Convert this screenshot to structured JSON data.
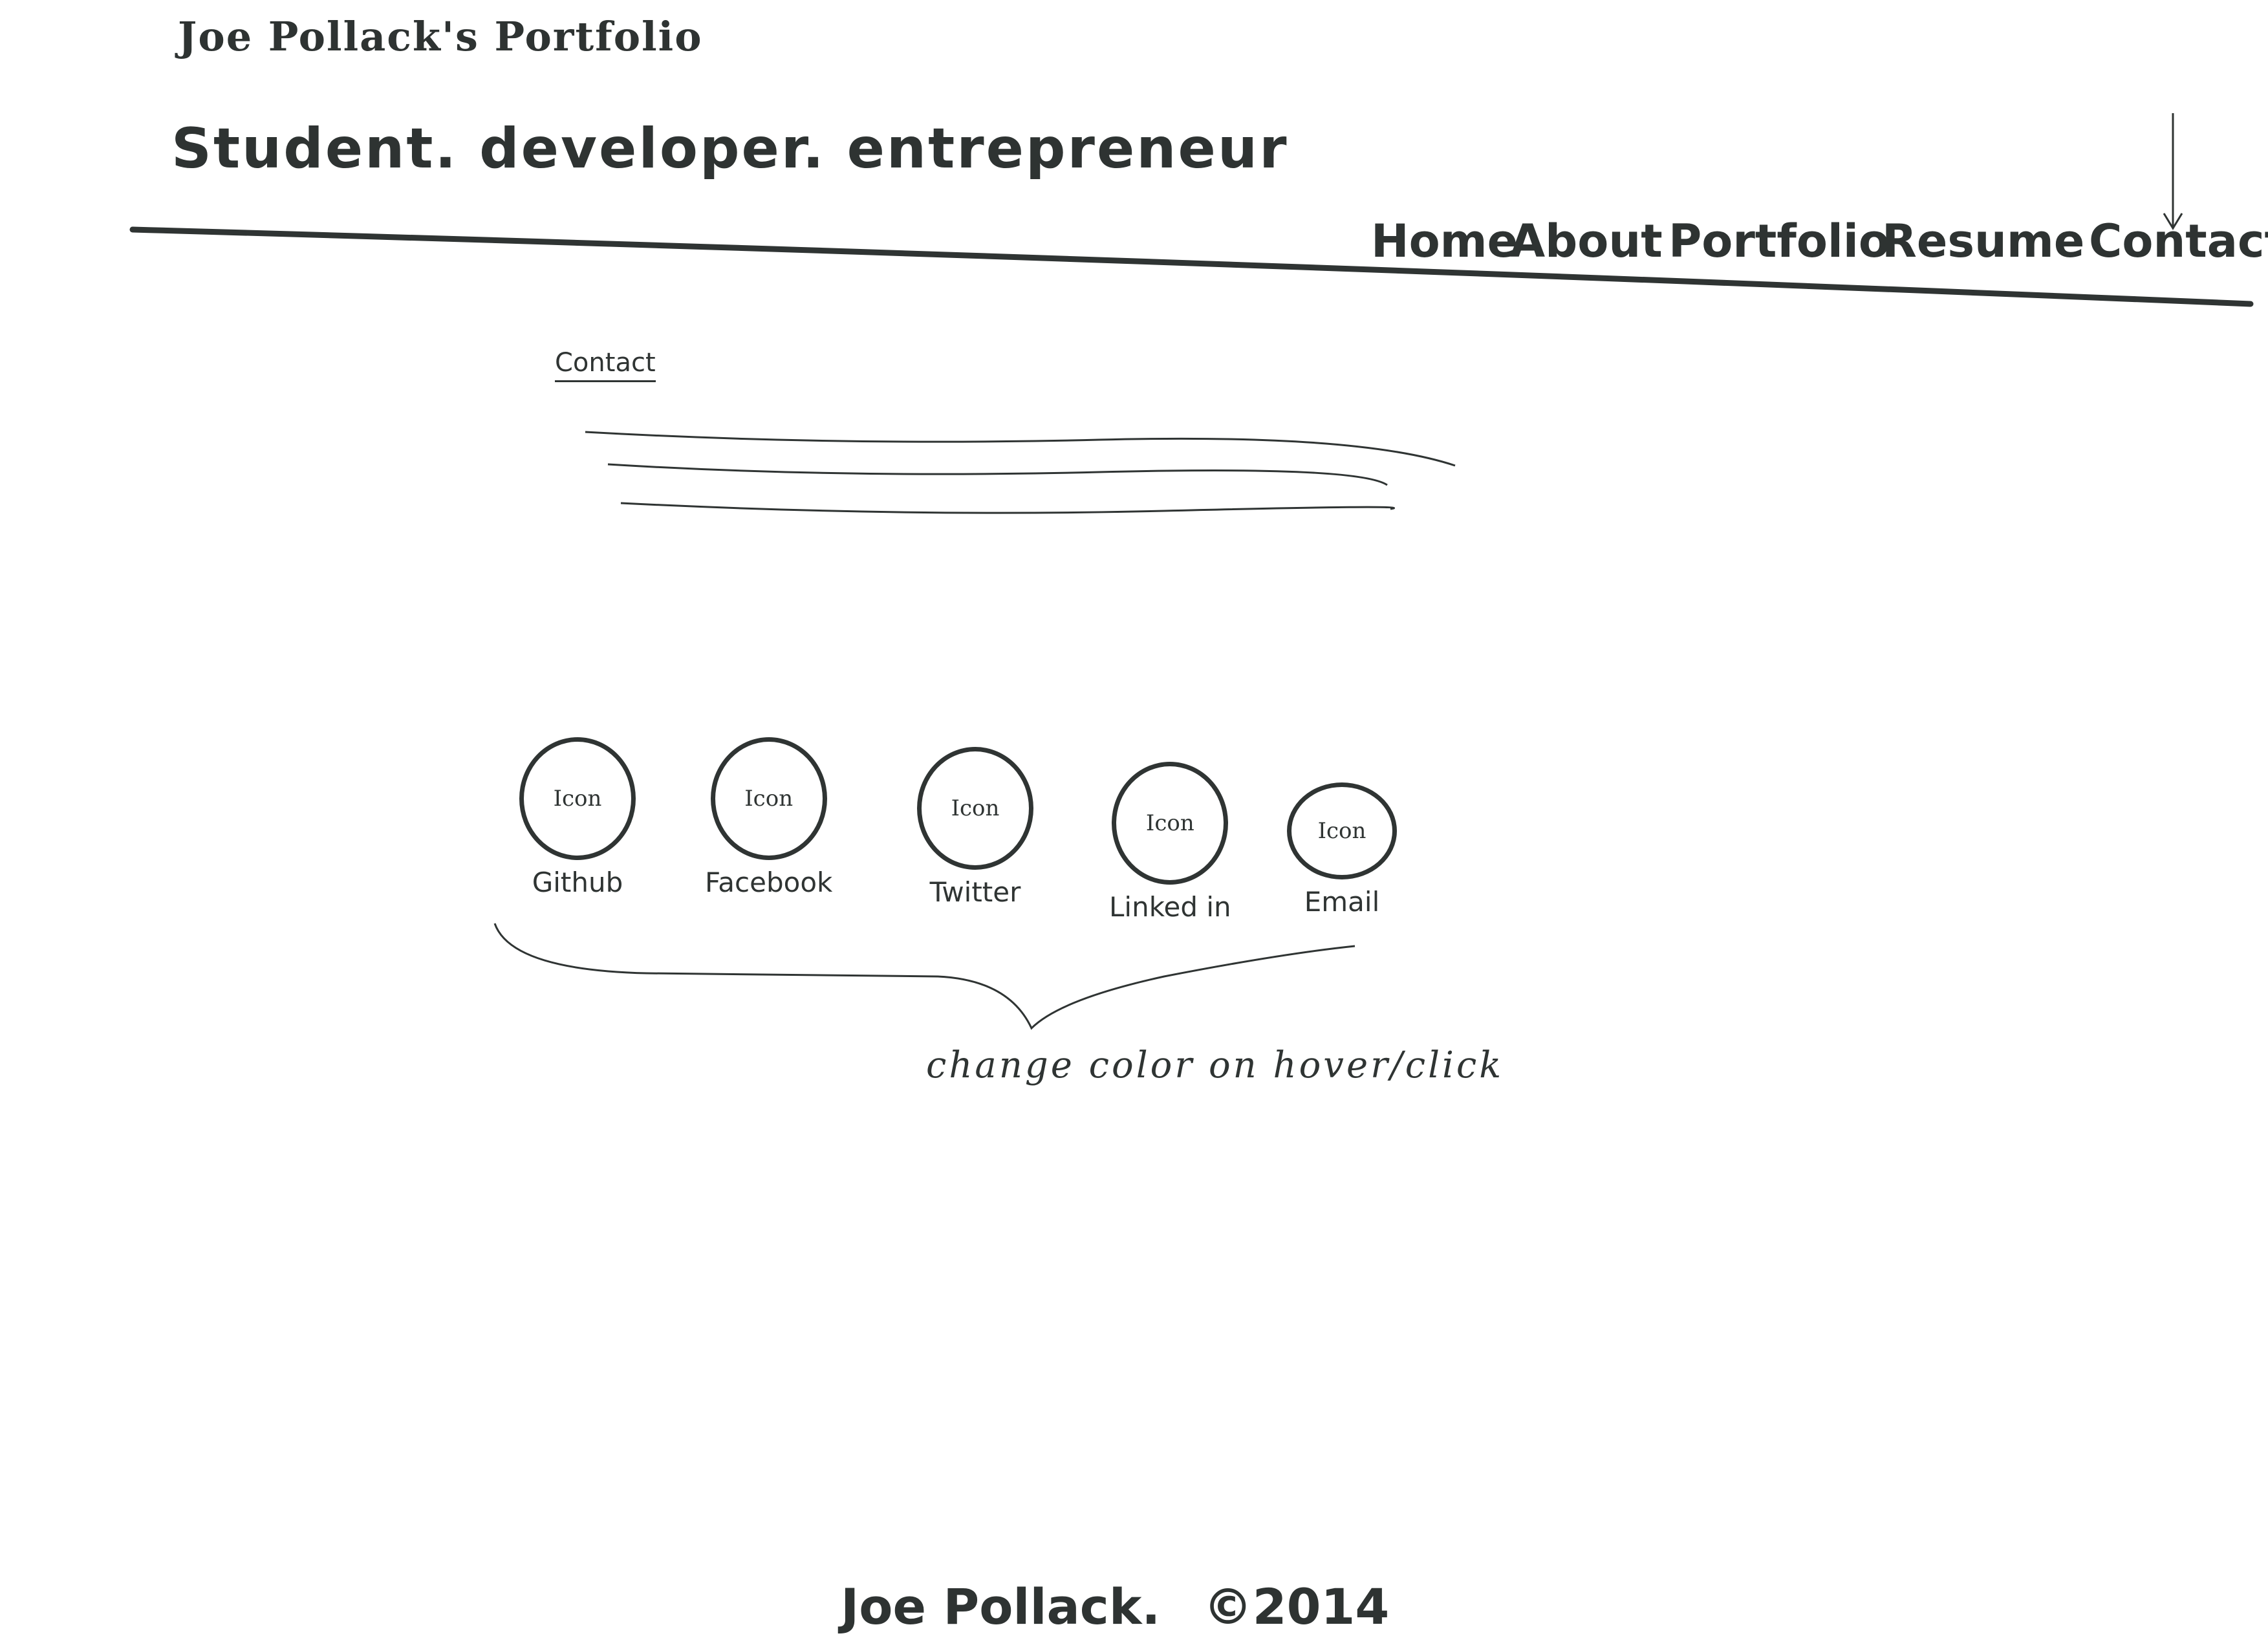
{
  "header": {
    "site_title": "Joe Pollack's Portfolio",
    "tagline": "Student. developer. entrepreneur"
  },
  "nav": {
    "items": [
      {
        "label": "Home"
      },
      {
        "label": "About"
      },
      {
        "label": "Portfolio"
      },
      {
        "label": "Resume"
      },
      {
        "label": "Contact"
      }
    ],
    "active": "Contact"
  },
  "contact": {
    "heading": "Contact"
  },
  "social": [
    {
      "icon_text": "Icon",
      "label": "Github",
      "icon": "github-icon"
    },
    {
      "icon_text": "Icon",
      "label": "Facebook",
      "icon": "facebook-icon"
    },
    {
      "icon_text": "Icon",
      "label": "Twitter",
      "icon": "twitter-icon"
    },
    {
      "icon_text": "Icon",
      "label": "Linked in",
      "icon": "linkedin-icon"
    },
    {
      "icon_text": "Icon",
      "label": "Email",
      "icon": "email-icon"
    }
  ],
  "annotation": "change color on hover/click",
  "footer": {
    "name": "Joe Pollack.",
    "copyright": "©2014"
  },
  "colors": {
    "ink": "#2f3433",
    "paper": "#ffffff"
  }
}
